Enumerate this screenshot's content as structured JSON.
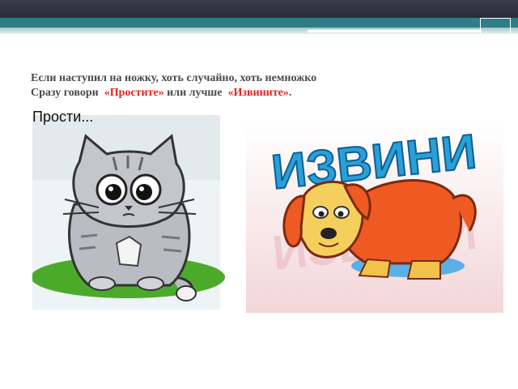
{
  "text": {
    "line1": "Если наступил на ножку, хоть случайно, хоть немножко",
    "line2_prefix": "Сразу говори  ",
    "line2_word1": "«Простите»",
    "line2_middle": " или лучше  ",
    "line2_word2": "«Извините»",
    "line2_end": "."
  },
  "cat_card": {
    "caption": "Прости..."
  },
  "dog_card": {
    "banner": "ИЗВИНИ"
  },
  "colors": {
    "accent_red": "#e8231f",
    "header_teal": "#2f7d86",
    "banner_blue": "#2a9fd8"
  }
}
